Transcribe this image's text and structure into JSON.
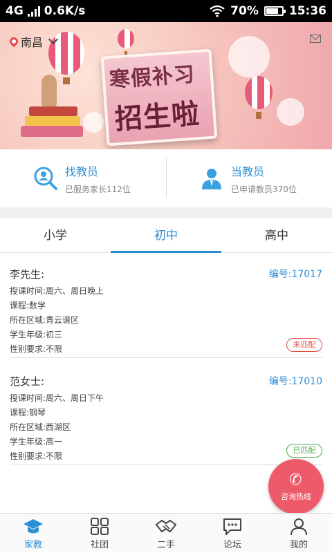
{
  "status_bar": {
    "network": "4G",
    "speed": "0.6K/s",
    "battery": "70%",
    "time": "15:36"
  },
  "header": {
    "city": "南昌"
  },
  "banner": {
    "line1": "寒假补习",
    "line2": "招生啦"
  },
  "actions": [
    {
      "title": "找教员",
      "sub": "已服务家长112位"
    },
    {
      "title": "当教员",
      "sub": "已申请教员370位"
    }
  ],
  "tabs": [
    {
      "label": "小学"
    },
    {
      "label": "初中"
    },
    {
      "label": "高中"
    }
  ],
  "listings": [
    {
      "name": "李先生:",
      "code": "编号:17017",
      "time": "授课时间:周六、周日晚上",
      "course": "课程:数学",
      "area": "所在区域:青云谱区",
      "grade": "学生年级:初三",
      "gender": "性别要求:不限",
      "status": "未匹配"
    },
    {
      "name": "范女士:",
      "code": "编号:17010",
      "time": "授课时间:周六、周日下午",
      "course": "课程:钢琴",
      "area": "所在区域:西湖区",
      "grade": "学生年级:高一",
      "gender": "性别要求:不限",
      "status": "已匹配"
    }
  ],
  "hotline": {
    "label": "咨询热线"
  },
  "bottom_nav": [
    {
      "label": "家教"
    },
    {
      "label": "社团"
    },
    {
      "label": "二手"
    },
    {
      "label": "论坛"
    },
    {
      "label": "我的"
    }
  ],
  "colors": {
    "accent": "#2c8fd6",
    "unmatched": "#e74c3c",
    "matched": "#4caf50",
    "hotline": "#ed5a6a"
  }
}
